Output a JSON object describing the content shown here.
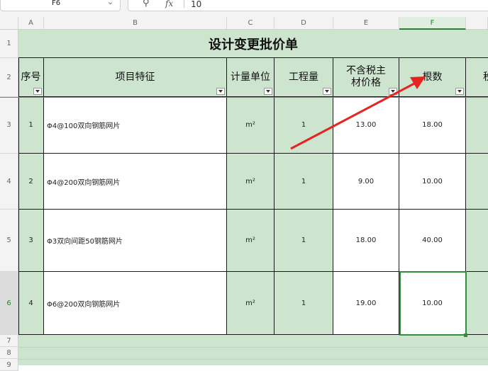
{
  "toolbar": {
    "cell_ref": "F6",
    "fx": "fx",
    "formula_value": "10"
  },
  "columns": [
    "A",
    "B",
    "C",
    "D",
    "E",
    "F"
  ],
  "rows": [
    "1",
    "2",
    "3",
    "4",
    "5",
    "6",
    "7",
    "8",
    "9"
  ],
  "sheet": {
    "title": "设计变更批价单",
    "headers": {
      "no": "序号",
      "item": "项目特征",
      "unit": "计量单位",
      "qty": "工程量",
      "price": "不含税主材价格",
      "count": "根数",
      "next": "税"
    },
    "data": [
      {
        "no": "1",
        "item": "Φ4@100双向钢筋网片",
        "unit": "m²",
        "qty": "1",
        "price": "13.00",
        "count": "18.00"
      },
      {
        "no": "2",
        "item": "Φ4@200双向钢筋网片",
        "unit": "m²",
        "qty": "1",
        "price": "9.00",
        "count": "10.00"
      },
      {
        "no": "3",
        "item": "Φ3双向间距50钢筋网片",
        "unit": "m²",
        "qty": "1",
        "price": "18.00",
        "count": "40.00"
      },
      {
        "no": "4",
        "item": "Φ6@200双向钢筋网片",
        "unit": "m²",
        "qty": "1",
        "price": "19.00",
        "count": "10.00"
      }
    ]
  },
  "annotation": {
    "arrow_color": "#e8231f"
  },
  "colors": {
    "sheet_fill": "#cde5cf",
    "selection": "#2f8f3a"
  }
}
